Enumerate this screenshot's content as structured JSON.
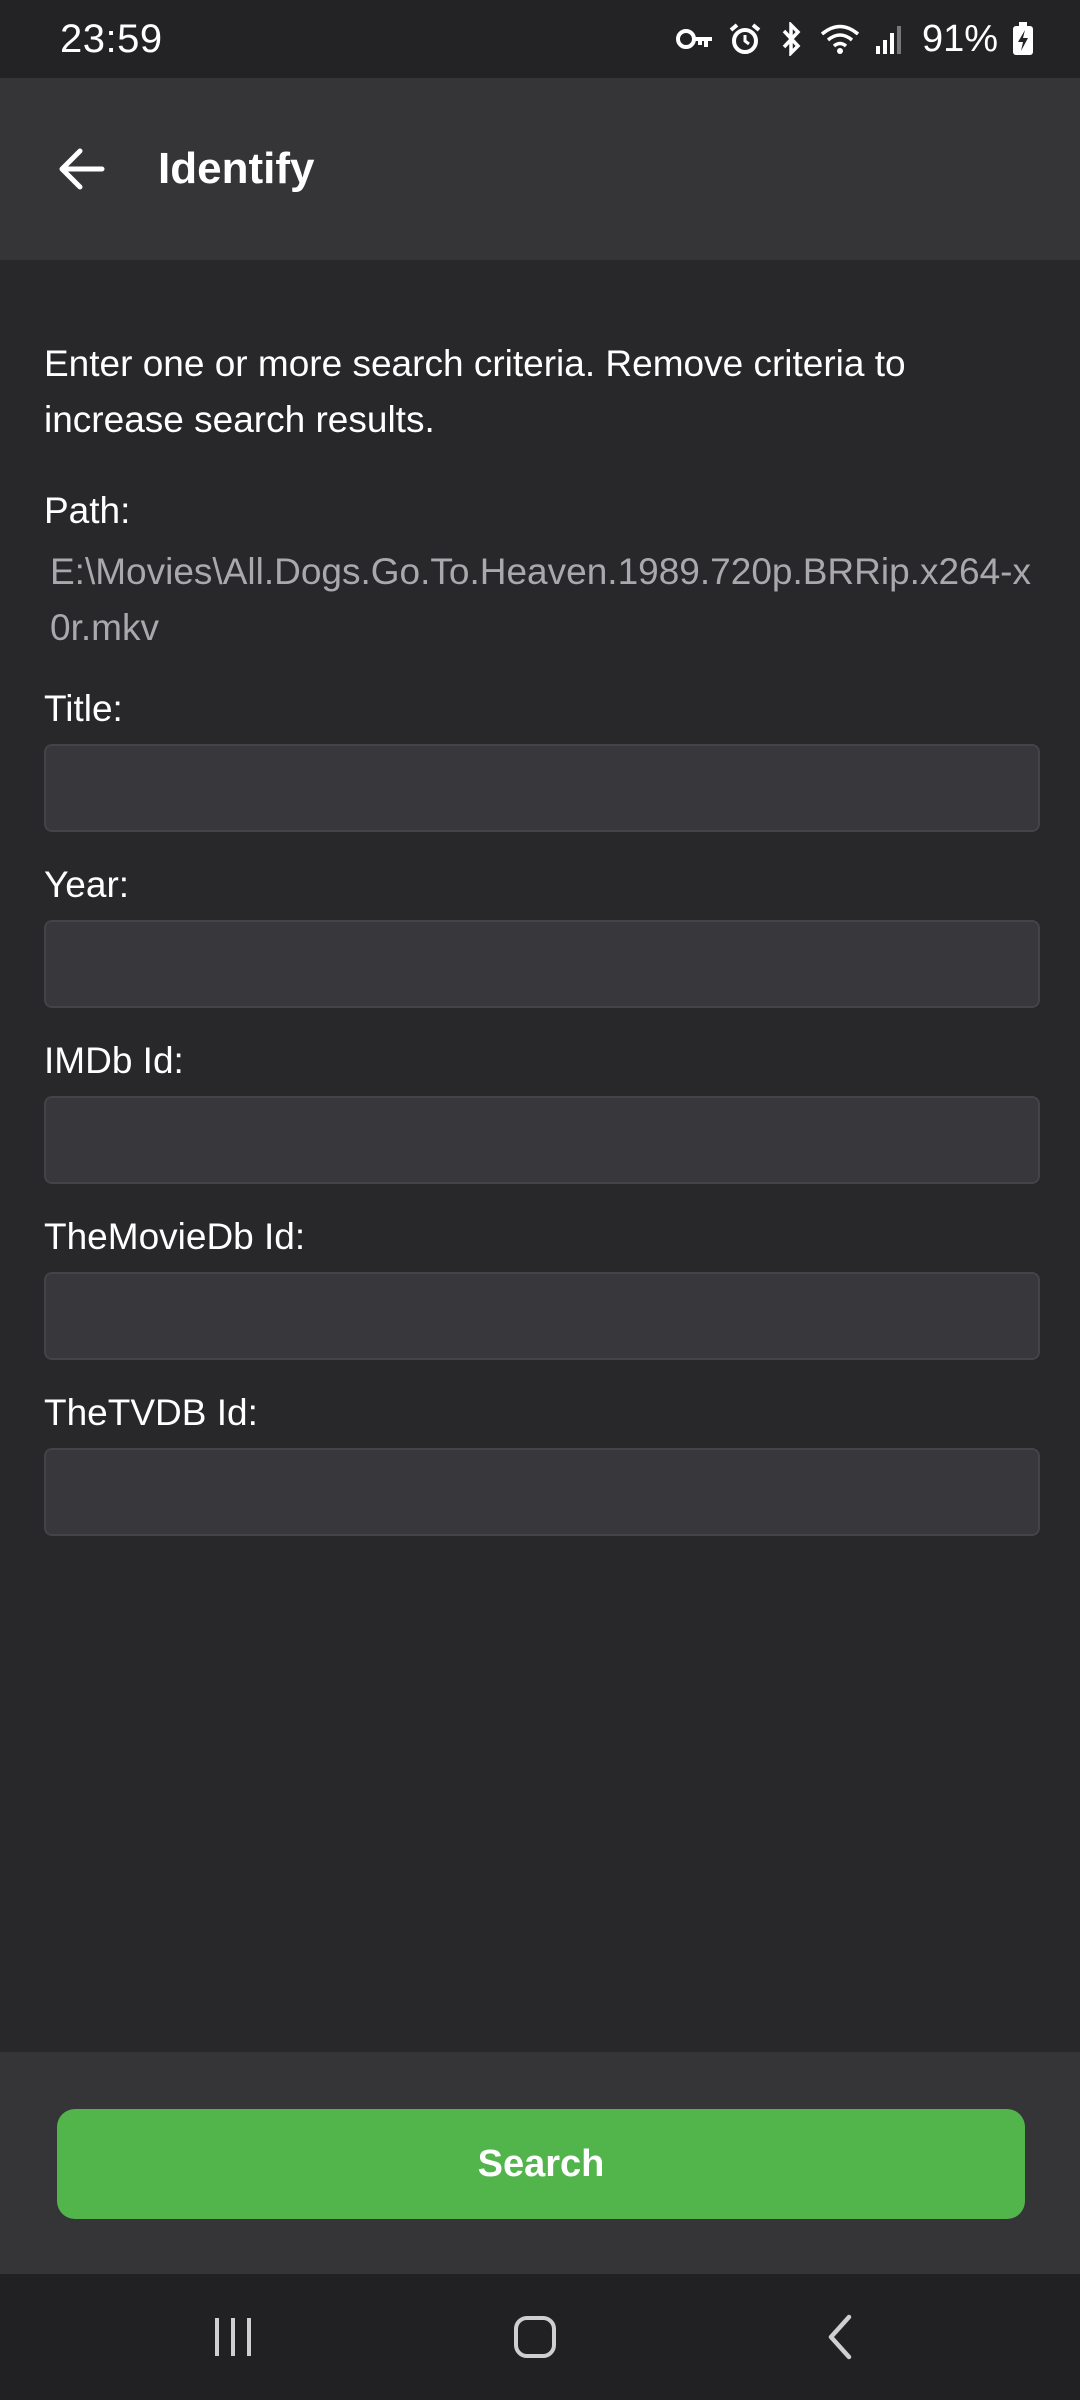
{
  "status_bar": {
    "time": "23:59",
    "battery": "91%",
    "icons": [
      "vpn-key-icon",
      "alarm-icon",
      "bluetooth-icon",
      "wifi-icon",
      "signal-icon",
      "battery-charging-icon"
    ]
  },
  "app_bar": {
    "title": "Identify",
    "back_icon": "arrow-left-icon"
  },
  "form": {
    "intro": "Enter one or more search criteria. Remove criteria to increase search results.",
    "path_label": "Path:",
    "path_value": "E:\\Movies\\All.Dogs.Go.To.Heaven.1989.720p.BRRip.x264-x0r.mkv",
    "fields": [
      {
        "label": "Title:",
        "value": ""
      },
      {
        "label": "Year:",
        "value": ""
      },
      {
        "label": "IMDb Id:",
        "value": ""
      },
      {
        "label": "TheMovieDb Id:",
        "value": ""
      },
      {
        "label": "TheTVDB Id:",
        "value": ""
      }
    ],
    "search_label": "Search"
  },
  "colors": {
    "background": "#28282b",
    "app_bar": "#353538",
    "accent": "#52b54b",
    "input_bg": "#38383c",
    "muted_text": "#a9a9ad"
  },
  "nav_bar": {
    "buttons": [
      "recents-icon",
      "home-icon",
      "back-icon"
    ]
  }
}
